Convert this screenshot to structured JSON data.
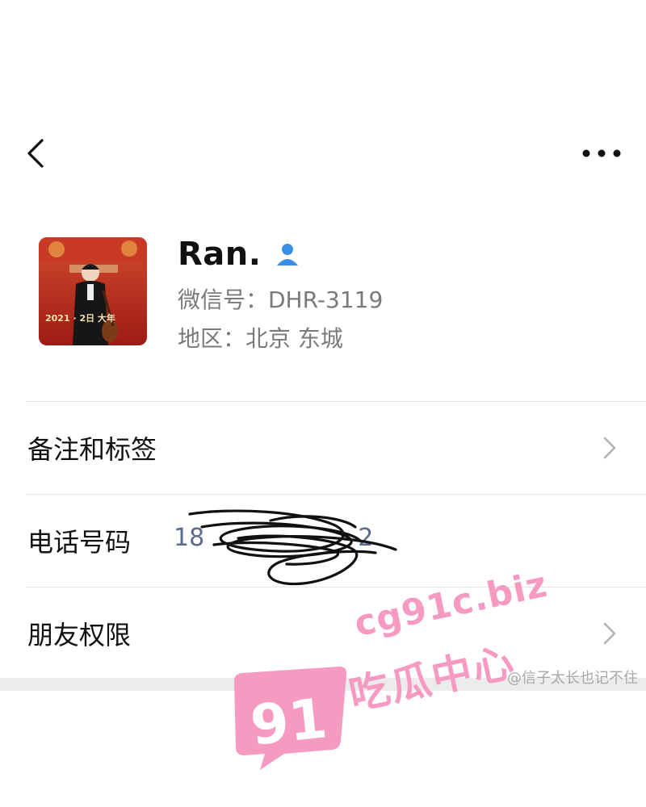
{
  "profile": {
    "name": "Ran.",
    "wechat_id": "微信号：DHR-3119",
    "region": "地区：北京 东城",
    "avatar_caption": "2021 · 2日 大年"
  },
  "rows": {
    "remarks_label": "备注和标签",
    "phone_label": "电话号码",
    "phone_value": "18",
    "phone_value_tail": "2",
    "permissions_label": "朋友权限"
  },
  "credit": "@信子太长也记不住",
  "watermark": {
    "badge": "91",
    "domain": "cg91c.biz",
    "cn_name": "吃瓜中心",
    "color": "#f79ac2"
  },
  "colors": {
    "accent_blue": "#3a8ee6",
    "phone_blue": "#5b6b93",
    "secondary_text": "#7a7a7a"
  },
  "icons": {
    "back": "chevron-left-icon",
    "more": "ellipsis-icon",
    "contact": "person-icon",
    "row_arrow": "chevron-right-icon"
  }
}
